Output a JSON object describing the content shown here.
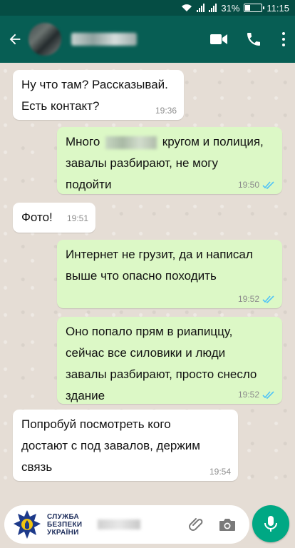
{
  "status_bar": {
    "battery": "31%",
    "battery_level": 0.31,
    "time": "11:15"
  },
  "app_bar": {
    "back_icon": "arrow-left-icon",
    "video_call_icon": "video-camera-icon",
    "voice_call_icon": "phone-icon",
    "menu_icon": "more-vertical-icon"
  },
  "messages": [
    {
      "direction": "incoming",
      "lines": [
        "Ну что там? Рассказывай.",
        "Есть контакт?"
      ],
      "time": "19:36"
    },
    {
      "direction": "outgoing",
      "text_before_redaction": "Много",
      "text_after_redaction": "кругом и полиция,",
      "lines": [
        "завалы разбирают, не могу",
        "подойти"
      ],
      "time": "19:50",
      "status": "read"
    },
    {
      "direction": "incoming",
      "lines": [
        "Фото!"
      ],
      "time": "19:51"
    },
    {
      "direction": "outgoing",
      "lines": [
        "Интернет не грузит, да и написал",
        "выше что опасно походить"
      ],
      "time": "19:52",
      "status": "read"
    },
    {
      "direction": "outgoing",
      "lines": [
        "Оно попало прям в риапиццу,",
        "сейчас все силовики и люди",
        "завалы разбирают, просто снесло",
        "здание"
      ],
      "time": "19:52",
      "status": "read"
    },
    {
      "direction": "incoming",
      "lines": [
        "Попробуй посмотреть кого",
        "достают с под завалов, держим",
        "связь"
      ],
      "time": "19:54"
    }
  ],
  "composer": {
    "org_line1": "СЛУЖБА",
    "org_line2": "БЕЗПЕКИ",
    "org_line3": "УКРАЇНИ",
    "attach_icon": "paperclip-icon",
    "camera_icon": "camera-icon",
    "mic_icon": "microphone-icon"
  },
  "colors": {
    "app_bar": "#075e54",
    "status_bar": "#054d44",
    "outgoing_bubble": "#dcf8c6",
    "incoming_bubble": "#ffffff",
    "read_ticks": "#4fc3f7",
    "mic_button": "#00a884"
  }
}
